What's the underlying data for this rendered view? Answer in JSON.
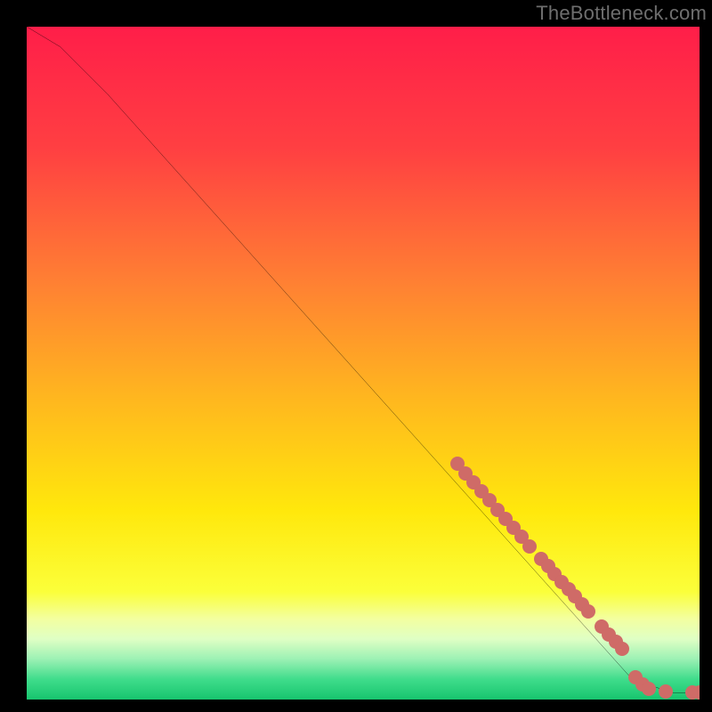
{
  "watermark": "TheBottleneck.com",
  "chart_data": {
    "type": "line",
    "title": "",
    "xlabel": "",
    "ylabel": "",
    "xlim": [
      0,
      100
    ],
    "ylim": [
      0,
      100
    ],
    "curve": [
      {
        "x": 0,
        "y": 100
      },
      {
        "x": 5,
        "y": 97
      },
      {
        "x": 12,
        "y": 90
      },
      {
        "x": 90,
        "y": 3
      },
      {
        "x": 96,
        "y": 1
      },
      {
        "x": 100,
        "y": 1
      }
    ],
    "markers": [
      {
        "x": 64.0,
        "y": 35.0
      },
      {
        "x": 65.2,
        "y": 33.6
      },
      {
        "x": 66.4,
        "y": 32.3
      },
      {
        "x": 67.6,
        "y": 30.9
      },
      {
        "x": 68.8,
        "y": 29.6
      },
      {
        "x": 70.0,
        "y": 28.2
      },
      {
        "x": 71.2,
        "y": 26.9
      },
      {
        "x": 72.4,
        "y": 25.5
      },
      {
        "x": 73.6,
        "y": 24.2
      },
      {
        "x": 74.8,
        "y": 22.8
      },
      {
        "x": 76.5,
        "y": 20.9
      },
      {
        "x": 77.5,
        "y": 19.8
      },
      {
        "x": 78.5,
        "y": 18.7
      },
      {
        "x": 79.5,
        "y": 17.5
      },
      {
        "x": 80.5,
        "y": 16.4
      },
      {
        "x": 81.5,
        "y": 15.3
      },
      {
        "x": 82.5,
        "y": 14.2
      },
      {
        "x": 83.5,
        "y": 13.1
      },
      {
        "x": 85.5,
        "y": 10.8
      },
      {
        "x": 86.5,
        "y": 9.7
      },
      {
        "x": 87.5,
        "y": 8.6
      },
      {
        "x": 88.5,
        "y": 7.5
      },
      {
        "x": 90.5,
        "y": 3.3
      },
      {
        "x": 91.5,
        "y": 2.2
      },
      {
        "x": 92.5,
        "y": 1.6
      },
      {
        "x": 95.0,
        "y": 1.2
      },
      {
        "x": 99.0,
        "y": 1.0
      },
      {
        "x": 100.0,
        "y": 1.0
      }
    ],
    "gradient_stops": [
      {
        "pct": 0,
        "color": "#ff1e49"
      },
      {
        "pct": 18,
        "color": "#ff3f42"
      },
      {
        "pct": 38,
        "color": "#ff8033"
      },
      {
        "pct": 55,
        "color": "#ffb61f"
      },
      {
        "pct": 72,
        "color": "#ffe80c"
      },
      {
        "pct": 84,
        "color": "#fbff3a"
      },
      {
        "pct": 88,
        "color": "#f3ffa0"
      },
      {
        "pct": 91,
        "color": "#dfffc4"
      },
      {
        "pct": 94,
        "color": "#9cf1b4"
      },
      {
        "pct": 97,
        "color": "#3fdc8b"
      },
      {
        "pct": 100,
        "color": "#17c56e"
      }
    ]
  }
}
